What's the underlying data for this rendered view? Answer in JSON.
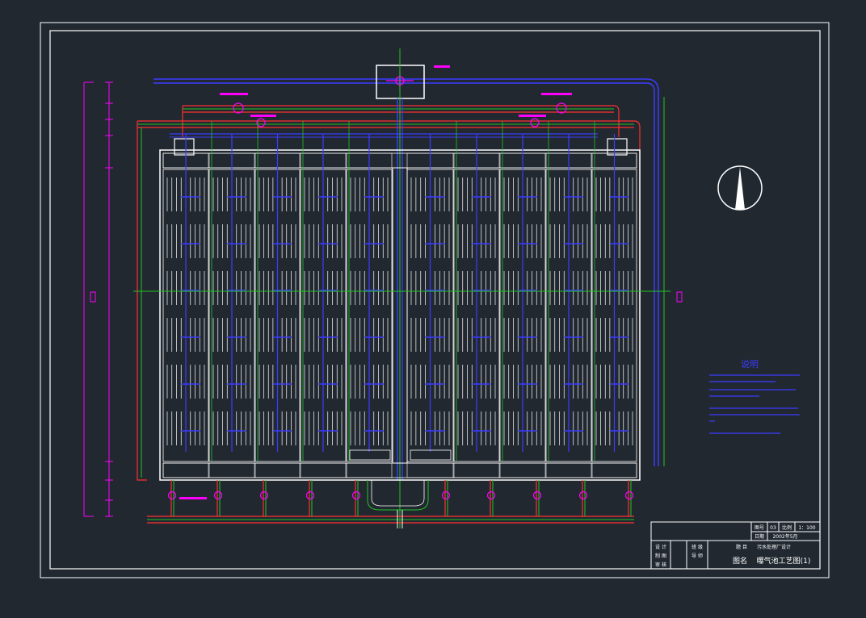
{
  "title_block": {
    "drawing_no_label": "图号",
    "drawing_no": "03",
    "scale_label": "比例",
    "scale": "1：100",
    "date_label": "日期",
    "date": "2002年5月",
    "design": "设 计",
    "drafting": "制 图",
    "review": "审 核",
    "class": "班 级",
    "supervisor": "导 师",
    "topic_label": "题 目",
    "topic": "污水处理厂设计",
    "drawing_name_label": "图名",
    "drawing_name": "曝气池工艺图(1)"
  },
  "notes": {
    "heading": "说明"
  },
  "colors": {
    "background": "#212830",
    "border": "#ffffff",
    "pipe_blue": "#3c3cff",
    "pipe_green": "#22c322",
    "pipe_red": "#ff3030",
    "magenta": "#ff00ff",
    "text_white": "#ffffff"
  }
}
